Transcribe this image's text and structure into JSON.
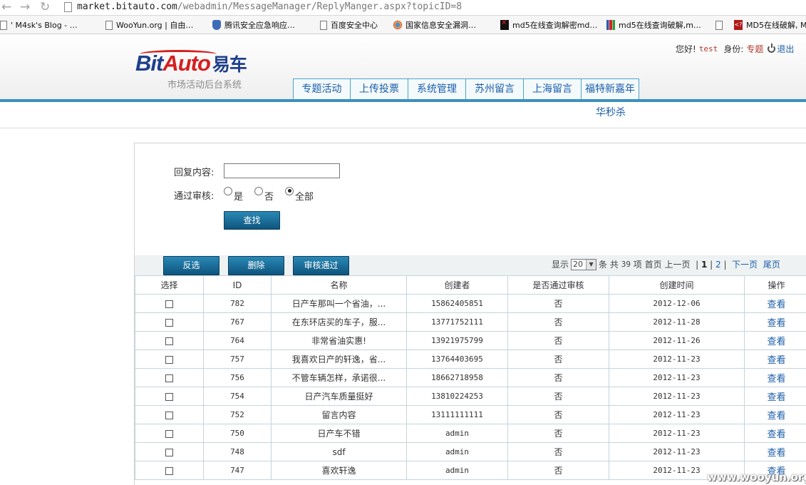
{
  "browser": {
    "url_host": "market.bitauto.com",
    "url_path": "/webadmin/MessageManager/ReplyManger.aspx?topicID=8",
    "bookmarks": [
      {
        "label": "' M4sk's Blog - …",
        "icon": "page-icon"
      },
      {
        "label": "WooYun.org | 自由…",
        "icon": "page-icon"
      },
      {
        "label": "腾讯安全应急响应…",
        "icon": "shield-icon"
      },
      {
        "label": "百度安全中心",
        "icon": "page-icon"
      },
      {
        "label": "国家信息安全漏洞…",
        "icon": "globe-icon"
      },
      {
        "label": "md5在线查询解密md…",
        "icon": "md5-icon"
      },
      {
        "label": "md5在线查询破解,m…",
        "icon": "grid-icon"
      },
      {
        "label": "",
        "icon": "page-icon"
      },
      {
        "label": "MD5在线破解, M",
        "icon": "md5-red-icon"
      }
    ]
  },
  "header": {
    "logo_text_1": "Bit",
    "logo_text_2": "Auto",
    "logo_text_cn": "易车",
    "subtitle": "市场活动后台系统",
    "greeting": "您好!",
    "username": "test",
    "role_label": "身份:",
    "role": "专题",
    "logout": "退出",
    "nav_tabs": [
      "专题活动",
      "上传投票",
      "系统管理",
      "苏州留言",
      "上海留言",
      "福特新嘉年"
    ],
    "sub_nav": "华秒杀"
  },
  "search": {
    "reply_label": "回复内容:",
    "reply_value": "",
    "audit_label": "通过审核:",
    "radio_options": [
      "是",
      "否",
      "全部"
    ],
    "radio_selected": 2,
    "search_button": "查找"
  },
  "toolbar": {
    "invert_button": "反选",
    "delete_button": "删除",
    "approve_button": "审核通过"
  },
  "pager": {
    "show_label": "显示",
    "page_size": "20",
    "unit_label": "条",
    "total_label": "共",
    "total": "39",
    "items_label": "项",
    "first": "首页",
    "prev": "上一页",
    "page_1": "1",
    "page_2": "2",
    "next": "下一页",
    "last": "尾页"
  },
  "table": {
    "columns": [
      "选择",
      "ID",
      "名称",
      "创建者",
      "是否通过审核",
      "创建时间",
      "操作"
    ],
    "rows": [
      {
        "id": "782",
        "name": "日产车那叫一个省油，...",
        "creator": "15862405851",
        "approved": "否",
        "created": "2012-12-06",
        "action": "查看"
      },
      {
        "id": "767",
        "name": "在东环店买的车子，服...",
        "creator": "13771752111",
        "approved": "否",
        "created": "2012-11-28",
        "action": "查看"
      },
      {
        "id": "764",
        "name": "非常省油实惠!",
        "creator": "13921975799",
        "approved": "否",
        "created": "2012-11-26",
        "action": "查看"
      },
      {
        "id": "757",
        "name": "我喜欢日产的轩逸，省...",
        "creator": "13764403695",
        "approved": "否",
        "created": "2012-11-23",
        "action": "查看"
      },
      {
        "id": "756",
        "name": "不管车辆怎样，承诺很...",
        "creator": "18662718958",
        "approved": "否",
        "created": "2012-11-23",
        "action": "查看"
      },
      {
        "id": "754",
        "name": "日产汽车质量挺好",
        "creator": "13810224253",
        "approved": "否",
        "created": "2012-11-23",
        "action": "查看"
      },
      {
        "id": "752",
        "name": "留言内容",
        "creator": "13111111111",
        "approved": "否",
        "created": "2012-11-23",
        "action": "查看"
      },
      {
        "id": "750",
        "name": "日产车不错",
        "creator": "admin",
        "approved": "否",
        "created": "2012-11-23",
        "action": "查看"
      },
      {
        "id": "748",
        "name": "sdf",
        "creator": "admin",
        "approved": "否",
        "created": "2012-11-23",
        "action": "查看"
      },
      {
        "id": "747",
        "name": "喜欢轩逸",
        "creator": "admin",
        "approved": "否",
        "created": "2012-11-23",
        "action": "查看"
      }
    ]
  },
  "watermark": "www.wooyun.org"
}
